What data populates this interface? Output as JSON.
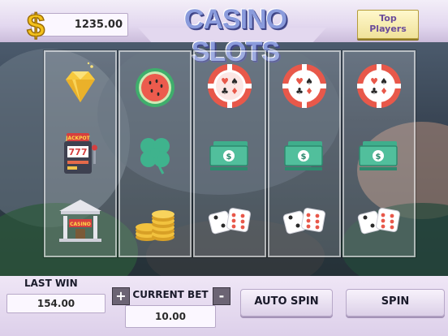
{
  "header": {
    "balance": "1235.00",
    "title": "CASINO SLOTS",
    "top_players_line1": "Top",
    "top_players_line2": "Players"
  },
  "reels": [
    {
      "symbols": [
        "diamond",
        "slot-machine",
        "casino-bank"
      ]
    },
    {
      "symbols": [
        "watermelon",
        "four-leaf-clover",
        "gold-coins"
      ]
    },
    {
      "symbols": [
        "poker-chip",
        "money-stack",
        "dice"
      ]
    },
    {
      "symbols": [
        "poker-chip",
        "money-stack",
        "dice"
      ]
    },
    {
      "symbols": [
        "poker-chip",
        "money-stack",
        "dice"
      ]
    }
  ],
  "symbol_text": {
    "slot_machine_sign": "JACKPOT",
    "slot_machine_digits": "777",
    "bank_sign": "CASINO"
  },
  "footer": {
    "last_win_label": "LAST WIN",
    "last_win_value": "154.00",
    "plus_label": "+",
    "current_bet_label": "CURRENT BET",
    "minus_label": "-",
    "current_bet_value": "10.00",
    "auto_spin_label": "AUTO SPIN",
    "spin_label": "SPIN"
  },
  "colors": {
    "title": "#8a9bdc",
    "chip_red": "#e8584a",
    "money_green": "#3fae8c",
    "diamond_gold": "#f5c23a",
    "clover_green": "#3fb38d"
  }
}
